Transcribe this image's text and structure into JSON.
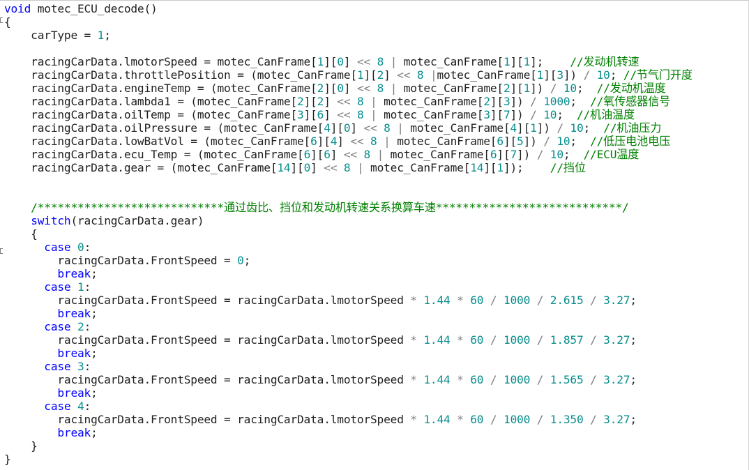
{
  "colors": {
    "keyword": "#0000ff",
    "number": "#098e8e",
    "comment": "#008000",
    "text": "#1f1f1f",
    "operator": "#7f7f7f"
  },
  "lines": [
    [
      {
        "t": "void",
        "c": "kw"
      },
      {
        "t": " motec_ECU_decode()",
        "c": "plain"
      }
    ],
    [
      {
        "t": "{",
        "c": "plain"
      }
    ],
    [
      {
        "t": "    carType = ",
        "c": "plain"
      },
      {
        "t": "1",
        "c": "num"
      },
      {
        "t": ";",
        "c": "plain"
      }
    ],
    [],
    [
      {
        "t": "    racingCarData.lmotorSpeed = motec_CanFrame[",
        "c": "plain"
      },
      {
        "t": "1",
        "c": "num"
      },
      {
        "t": "][",
        "c": "plain"
      },
      {
        "t": "0",
        "c": "num"
      },
      {
        "t": "] ",
        "c": "plain"
      },
      {
        "t": "<<",
        "c": "op"
      },
      {
        "t": " ",
        "c": "plain"
      },
      {
        "t": "8",
        "c": "num"
      },
      {
        "t": " ",
        "c": "plain"
      },
      {
        "t": "|",
        "c": "op"
      },
      {
        "t": " motec_CanFrame[",
        "c": "plain"
      },
      {
        "t": "1",
        "c": "num"
      },
      {
        "t": "][",
        "c": "plain"
      },
      {
        "t": "1",
        "c": "num"
      },
      {
        "t": "];    ",
        "c": "plain"
      },
      {
        "t": "//发动机转速",
        "c": "cm"
      }
    ],
    [
      {
        "t": "    racingCarData.throttlePosition = (motec_CanFrame[",
        "c": "plain"
      },
      {
        "t": "1",
        "c": "num"
      },
      {
        "t": "][",
        "c": "plain"
      },
      {
        "t": "2",
        "c": "num"
      },
      {
        "t": "] ",
        "c": "plain"
      },
      {
        "t": "<<",
        "c": "op"
      },
      {
        "t": " ",
        "c": "plain"
      },
      {
        "t": "8",
        "c": "num"
      },
      {
        "t": " ",
        "c": "plain"
      },
      {
        "t": "|",
        "c": "op"
      },
      {
        "t": "motec_CanFrame[",
        "c": "plain"
      },
      {
        "t": "1",
        "c": "num"
      },
      {
        "t": "][",
        "c": "plain"
      },
      {
        "t": "3",
        "c": "num"
      },
      {
        "t": "]) ",
        "c": "plain"
      },
      {
        "t": "/",
        "c": "op"
      },
      {
        "t": " ",
        "c": "plain"
      },
      {
        "t": "10",
        "c": "num"
      },
      {
        "t": "; ",
        "c": "plain"
      },
      {
        "t": "//节气门开度",
        "c": "cm"
      }
    ],
    [
      {
        "t": "    racingCarData.engineTemp = (motec_CanFrame[",
        "c": "plain"
      },
      {
        "t": "2",
        "c": "num"
      },
      {
        "t": "][",
        "c": "plain"
      },
      {
        "t": "0",
        "c": "num"
      },
      {
        "t": "] ",
        "c": "plain"
      },
      {
        "t": "<<",
        "c": "op"
      },
      {
        "t": " ",
        "c": "plain"
      },
      {
        "t": "8",
        "c": "num"
      },
      {
        "t": " ",
        "c": "plain"
      },
      {
        "t": "|",
        "c": "op"
      },
      {
        "t": " motec_CanFrame[",
        "c": "plain"
      },
      {
        "t": "2",
        "c": "num"
      },
      {
        "t": "][",
        "c": "plain"
      },
      {
        "t": "1",
        "c": "num"
      },
      {
        "t": "]) ",
        "c": "plain"
      },
      {
        "t": "/",
        "c": "op"
      },
      {
        "t": " ",
        "c": "plain"
      },
      {
        "t": "10",
        "c": "num"
      },
      {
        "t": ";  ",
        "c": "plain"
      },
      {
        "t": "//发动机温度",
        "c": "cm"
      }
    ],
    [
      {
        "t": "    racingCarData.lambda1 = (motec_CanFrame[",
        "c": "plain"
      },
      {
        "t": "2",
        "c": "num"
      },
      {
        "t": "][",
        "c": "plain"
      },
      {
        "t": "2",
        "c": "num"
      },
      {
        "t": "] ",
        "c": "plain"
      },
      {
        "t": "<<",
        "c": "op"
      },
      {
        "t": " ",
        "c": "plain"
      },
      {
        "t": "8",
        "c": "num"
      },
      {
        "t": " ",
        "c": "plain"
      },
      {
        "t": "|",
        "c": "op"
      },
      {
        "t": " motec_CanFrame[",
        "c": "plain"
      },
      {
        "t": "2",
        "c": "num"
      },
      {
        "t": "][",
        "c": "plain"
      },
      {
        "t": "3",
        "c": "num"
      },
      {
        "t": "]) ",
        "c": "plain"
      },
      {
        "t": "/",
        "c": "op"
      },
      {
        "t": " ",
        "c": "plain"
      },
      {
        "t": "1000",
        "c": "num"
      },
      {
        "t": ";  ",
        "c": "plain"
      },
      {
        "t": "//氧传感器信号",
        "c": "cm"
      }
    ],
    [
      {
        "t": "    racingCarData.oilTemp = (motec_CanFrame[",
        "c": "plain"
      },
      {
        "t": "3",
        "c": "num"
      },
      {
        "t": "][",
        "c": "plain"
      },
      {
        "t": "6",
        "c": "num"
      },
      {
        "t": "] ",
        "c": "plain"
      },
      {
        "t": "<<",
        "c": "op"
      },
      {
        "t": " ",
        "c": "plain"
      },
      {
        "t": "8",
        "c": "num"
      },
      {
        "t": " ",
        "c": "plain"
      },
      {
        "t": "|",
        "c": "op"
      },
      {
        "t": " motec_CanFrame[",
        "c": "plain"
      },
      {
        "t": "3",
        "c": "num"
      },
      {
        "t": "][",
        "c": "plain"
      },
      {
        "t": "7",
        "c": "num"
      },
      {
        "t": "]) ",
        "c": "plain"
      },
      {
        "t": "/",
        "c": "op"
      },
      {
        "t": " ",
        "c": "plain"
      },
      {
        "t": "10",
        "c": "num"
      },
      {
        "t": ";  ",
        "c": "plain"
      },
      {
        "t": "//机油温度",
        "c": "cm"
      }
    ],
    [
      {
        "t": "    racingCarData.oilPressure = (motec_CanFrame[",
        "c": "plain"
      },
      {
        "t": "4",
        "c": "num"
      },
      {
        "t": "][",
        "c": "plain"
      },
      {
        "t": "0",
        "c": "num"
      },
      {
        "t": "] ",
        "c": "plain"
      },
      {
        "t": "<<",
        "c": "op"
      },
      {
        "t": " ",
        "c": "plain"
      },
      {
        "t": "8",
        "c": "num"
      },
      {
        "t": " ",
        "c": "plain"
      },
      {
        "t": "|",
        "c": "op"
      },
      {
        "t": " motec_CanFrame[",
        "c": "plain"
      },
      {
        "t": "4",
        "c": "num"
      },
      {
        "t": "][",
        "c": "plain"
      },
      {
        "t": "1",
        "c": "num"
      },
      {
        "t": "]) ",
        "c": "plain"
      },
      {
        "t": "/",
        "c": "op"
      },
      {
        "t": " ",
        "c": "plain"
      },
      {
        "t": "10",
        "c": "num"
      },
      {
        "t": ";  ",
        "c": "plain"
      },
      {
        "t": "//机油压力",
        "c": "cm"
      }
    ],
    [
      {
        "t": "    racingCarData.lowBatVol = (motec_CanFrame[",
        "c": "plain"
      },
      {
        "t": "6",
        "c": "num"
      },
      {
        "t": "][",
        "c": "plain"
      },
      {
        "t": "4",
        "c": "num"
      },
      {
        "t": "] ",
        "c": "plain"
      },
      {
        "t": "<<",
        "c": "op"
      },
      {
        "t": " ",
        "c": "plain"
      },
      {
        "t": "8",
        "c": "num"
      },
      {
        "t": " ",
        "c": "plain"
      },
      {
        "t": "|",
        "c": "op"
      },
      {
        "t": " motec_CanFrame[",
        "c": "plain"
      },
      {
        "t": "6",
        "c": "num"
      },
      {
        "t": "][",
        "c": "plain"
      },
      {
        "t": "5",
        "c": "num"
      },
      {
        "t": "]) ",
        "c": "plain"
      },
      {
        "t": "/",
        "c": "op"
      },
      {
        "t": " ",
        "c": "plain"
      },
      {
        "t": "10",
        "c": "num"
      },
      {
        "t": ";  ",
        "c": "plain"
      },
      {
        "t": "//低压电池电压",
        "c": "cm"
      }
    ],
    [
      {
        "t": "    racingCarData.ecu_Temp = (motec_CanFrame[",
        "c": "plain"
      },
      {
        "t": "6",
        "c": "num"
      },
      {
        "t": "][",
        "c": "plain"
      },
      {
        "t": "6",
        "c": "num"
      },
      {
        "t": "] ",
        "c": "plain"
      },
      {
        "t": "<<",
        "c": "op"
      },
      {
        "t": " ",
        "c": "plain"
      },
      {
        "t": "8",
        "c": "num"
      },
      {
        "t": " ",
        "c": "plain"
      },
      {
        "t": "|",
        "c": "op"
      },
      {
        "t": " motec_CanFrame[",
        "c": "plain"
      },
      {
        "t": "6",
        "c": "num"
      },
      {
        "t": "][",
        "c": "plain"
      },
      {
        "t": "7",
        "c": "num"
      },
      {
        "t": "]) ",
        "c": "plain"
      },
      {
        "t": "/",
        "c": "op"
      },
      {
        "t": " ",
        "c": "plain"
      },
      {
        "t": "10",
        "c": "num"
      },
      {
        "t": ";  ",
        "c": "plain"
      },
      {
        "t": "//ECU温度",
        "c": "cm"
      }
    ],
    [
      {
        "t": "    racingCarData.gear = (motec_CanFrame[",
        "c": "plain"
      },
      {
        "t": "14",
        "c": "num"
      },
      {
        "t": "][",
        "c": "plain"
      },
      {
        "t": "0",
        "c": "num"
      },
      {
        "t": "] ",
        "c": "plain"
      },
      {
        "t": "<<",
        "c": "op"
      },
      {
        "t": " ",
        "c": "plain"
      },
      {
        "t": "8",
        "c": "num"
      },
      {
        "t": " ",
        "c": "plain"
      },
      {
        "t": "|",
        "c": "op"
      },
      {
        "t": " motec_CanFrame[",
        "c": "plain"
      },
      {
        "t": "14",
        "c": "num"
      },
      {
        "t": "][",
        "c": "plain"
      },
      {
        "t": "1",
        "c": "num"
      },
      {
        "t": "]);    ",
        "c": "plain"
      },
      {
        "t": "//挡位",
        "c": "cm"
      }
    ],
    [],
    [],
    [
      {
        "t": "    /****************************通过齿比、挡位和发动机转速关系换算车速****************************/",
        "c": "cm"
      }
    ],
    [
      {
        "t": "    ",
        "c": "plain"
      },
      {
        "t": "switch",
        "c": "kw"
      },
      {
        "t": "(racingCarData.gear)",
        "c": "plain"
      }
    ],
    [
      {
        "t": "    {",
        "c": "plain"
      }
    ],
    [
      {
        "t": "      ",
        "c": "plain"
      },
      {
        "t": "case",
        "c": "kw"
      },
      {
        "t": " ",
        "c": "plain"
      },
      {
        "t": "0",
        "c": "num"
      },
      {
        "t": ":",
        "c": "plain"
      }
    ],
    [
      {
        "t": "        racingCarData.FrontSpeed = ",
        "c": "plain"
      },
      {
        "t": "0",
        "c": "num"
      },
      {
        "t": ";",
        "c": "plain"
      }
    ],
    [
      {
        "t": "        ",
        "c": "plain"
      },
      {
        "t": "break",
        "c": "kw"
      },
      {
        "t": ";",
        "c": "plain"
      }
    ],
    [
      {
        "t": "      ",
        "c": "plain"
      },
      {
        "t": "case",
        "c": "kw"
      },
      {
        "t": " ",
        "c": "plain"
      },
      {
        "t": "1",
        "c": "num"
      },
      {
        "t": ":",
        "c": "plain"
      }
    ],
    [
      {
        "t": "        racingCarData.FrontSpeed = racingCarData.lmotorSpeed ",
        "c": "plain"
      },
      {
        "t": "*",
        "c": "op"
      },
      {
        "t": " ",
        "c": "plain"
      },
      {
        "t": "1.44",
        "c": "num"
      },
      {
        "t": " ",
        "c": "plain"
      },
      {
        "t": "*",
        "c": "op"
      },
      {
        "t": " ",
        "c": "plain"
      },
      {
        "t": "60",
        "c": "num"
      },
      {
        "t": " ",
        "c": "plain"
      },
      {
        "t": "/",
        "c": "op"
      },
      {
        "t": " ",
        "c": "plain"
      },
      {
        "t": "1000",
        "c": "num"
      },
      {
        "t": " ",
        "c": "plain"
      },
      {
        "t": "/",
        "c": "op"
      },
      {
        "t": " ",
        "c": "plain"
      },
      {
        "t": "2.615",
        "c": "num"
      },
      {
        "t": " ",
        "c": "plain"
      },
      {
        "t": "/",
        "c": "op"
      },
      {
        "t": " ",
        "c": "plain"
      },
      {
        "t": "3.27",
        "c": "num"
      },
      {
        "t": ";",
        "c": "plain"
      }
    ],
    [
      {
        "t": "        ",
        "c": "plain"
      },
      {
        "t": "break",
        "c": "kw"
      },
      {
        "t": ";",
        "c": "plain"
      }
    ],
    [
      {
        "t": "      ",
        "c": "plain"
      },
      {
        "t": "case",
        "c": "kw"
      },
      {
        "t": " ",
        "c": "plain"
      },
      {
        "t": "2",
        "c": "num"
      },
      {
        "t": ":",
        "c": "plain"
      }
    ],
    [
      {
        "t": "        racingCarData.FrontSpeed = racingCarData.lmotorSpeed ",
        "c": "plain"
      },
      {
        "t": "*",
        "c": "op"
      },
      {
        "t": " ",
        "c": "plain"
      },
      {
        "t": "1.44",
        "c": "num"
      },
      {
        "t": " ",
        "c": "plain"
      },
      {
        "t": "*",
        "c": "op"
      },
      {
        "t": " ",
        "c": "plain"
      },
      {
        "t": "60",
        "c": "num"
      },
      {
        "t": " ",
        "c": "plain"
      },
      {
        "t": "/",
        "c": "op"
      },
      {
        "t": " ",
        "c": "plain"
      },
      {
        "t": "1000",
        "c": "num"
      },
      {
        "t": " ",
        "c": "plain"
      },
      {
        "t": "/",
        "c": "op"
      },
      {
        "t": " ",
        "c": "plain"
      },
      {
        "t": "1.857",
        "c": "num"
      },
      {
        "t": " ",
        "c": "plain"
      },
      {
        "t": "/",
        "c": "op"
      },
      {
        "t": " ",
        "c": "plain"
      },
      {
        "t": "3.27",
        "c": "num"
      },
      {
        "t": ";",
        "c": "plain"
      }
    ],
    [
      {
        "t": "        ",
        "c": "plain"
      },
      {
        "t": "break",
        "c": "kw"
      },
      {
        "t": ";",
        "c": "plain"
      }
    ],
    [
      {
        "t": "      ",
        "c": "plain"
      },
      {
        "t": "case",
        "c": "kw"
      },
      {
        "t": " ",
        "c": "plain"
      },
      {
        "t": "3",
        "c": "num"
      },
      {
        "t": ":",
        "c": "plain"
      }
    ],
    [
      {
        "t": "        racingCarData.FrontSpeed = racingCarData.lmotorSpeed ",
        "c": "plain"
      },
      {
        "t": "*",
        "c": "op"
      },
      {
        "t": " ",
        "c": "plain"
      },
      {
        "t": "1.44",
        "c": "num"
      },
      {
        "t": " ",
        "c": "plain"
      },
      {
        "t": "*",
        "c": "op"
      },
      {
        "t": " ",
        "c": "plain"
      },
      {
        "t": "60",
        "c": "num"
      },
      {
        "t": " ",
        "c": "plain"
      },
      {
        "t": "/",
        "c": "op"
      },
      {
        "t": " ",
        "c": "plain"
      },
      {
        "t": "1000",
        "c": "num"
      },
      {
        "t": " ",
        "c": "plain"
      },
      {
        "t": "/",
        "c": "op"
      },
      {
        "t": " ",
        "c": "plain"
      },
      {
        "t": "1.565",
        "c": "num"
      },
      {
        "t": " ",
        "c": "plain"
      },
      {
        "t": "/",
        "c": "op"
      },
      {
        "t": " ",
        "c": "plain"
      },
      {
        "t": "3.27",
        "c": "num"
      },
      {
        "t": ";",
        "c": "plain"
      }
    ],
    [
      {
        "t": "        ",
        "c": "plain"
      },
      {
        "t": "break",
        "c": "kw"
      },
      {
        "t": ";",
        "c": "plain"
      }
    ],
    [
      {
        "t": "      ",
        "c": "plain"
      },
      {
        "t": "case",
        "c": "kw"
      },
      {
        "t": " ",
        "c": "plain"
      },
      {
        "t": "4",
        "c": "num"
      },
      {
        "t": ":",
        "c": "plain"
      }
    ],
    [
      {
        "t": "        racingCarData.FrontSpeed = racingCarData.lmotorSpeed ",
        "c": "plain"
      },
      {
        "t": "*",
        "c": "op"
      },
      {
        "t": " ",
        "c": "plain"
      },
      {
        "t": "1.44",
        "c": "num"
      },
      {
        "t": " ",
        "c": "plain"
      },
      {
        "t": "*",
        "c": "op"
      },
      {
        "t": " ",
        "c": "plain"
      },
      {
        "t": "60",
        "c": "num"
      },
      {
        "t": " ",
        "c": "plain"
      },
      {
        "t": "/",
        "c": "op"
      },
      {
        "t": " ",
        "c": "plain"
      },
      {
        "t": "1000",
        "c": "num"
      },
      {
        "t": " ",
        "c": "plain"
      },
      {
        "t": "/",
        "c": "op"
      },
      {
        "t": " ",
        "c": "plain"
      },
      {
        "t": "1.350",
        "c": "num"
      },
      {
        "t": " ",
        "c": "plain"
      },
      {
        "t": "/",
        "c": "op"
      },
      {
        "t": " ",
        "c": "plain"
      },
      {
        "t": "3.27",
        "c": "num"
      },
      {
        "t": ";",
        "c": "plain"
      }
    ],
    [
      {
        "t": "        ",
        "c": "plain"
      },
      {
        "t": "break",
        "c": "kw"
      },
      {
        "t": ";",
        "c": "plain"
      }
    ],
    [
      {
        "t": "    }",
        "c": "plain"
      }
    ],
    [
      {
        "t": "}",
        "c": "plain"
      }
    ]
  ]
}
